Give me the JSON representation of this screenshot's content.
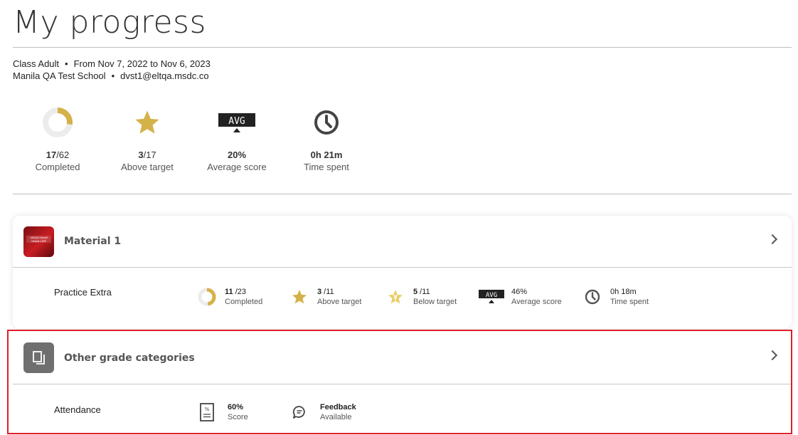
{
  "page": {
    "title": "My progress"
  },
  "meta": {
    "class": "Class Adult",
    "period": "From Nov 7, 2022 to Nov 6, 2023",
    "school": "Manila QA Test School",
    "email": "dvst1@eltqa.msdc.co"
  },
  "summary": {
    "completed": {
      "done": "17",
      "total": "/62",
      "label": "Completed",
      "fraction": 0.274
    },
    "above_target": {
      "done": "3",
      "total": "/17",
      "label": "Above target"
    },
    "average": {
      "badge": "AVG",
      "value": "20%",
      "label": "Average score"
    },
    "time": {
      "value": "0h 21m",
      "label": "Time spent"
    }
  },
  "material": {
    "title": "Material 1",
    "thumb_text": "UMQA Global Virtual LIVE",
    "row": {
      "name": "Practice Extra",
      "completed": {
        "done": "11",
        "total": " /23",
        "label": "Completed",
        "fraction": 0.478
      },
      "above": {
        "done": "3",
        "total": " /11",
        "label": "Above target"
      },
      "below": {
        "done": "5",
        "total": " /11",
        "label": "Below target"
      },
      "average": {
        "badge": "AVG",
        "value": "46%",
        "label": "Average score"
      },
      "time": {
        "value": "0h 18m",
        "label": "Time spent"
      }
    }
  },
  "other": {
    "title": "Other grade categories",
    "row": {
      "name": "Attendance",
      "score": {
        "value": "60%",
        "label": "Score",
        "icon_text": "%"
      },
      "feedback": {
        "value": "Feedback",
        "label": "Available"
      }
    }
  },
  "colors": {
    "gold": "#d4b24a",
    "highlight": "#e01e2b"
  }
}
